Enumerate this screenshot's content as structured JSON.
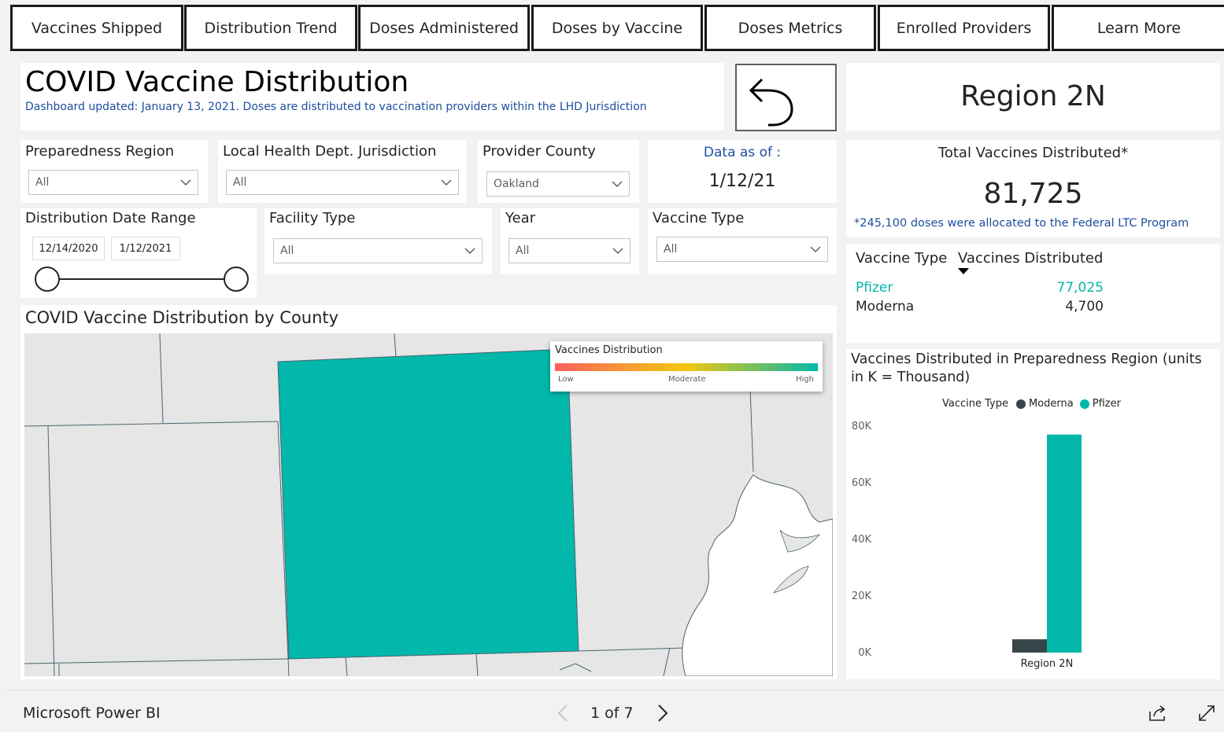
{
  "tabs": [
    {
      "label": "Vaccines Shipped"
    },
    {
      "label": "Distribution Trend"
    },
    {
      "label": "Doses Administered"
    },
    {
      "label": "Doses by Vaccine"
    },
    {
      "label": "Doses Metrics"
    },
    {
      "label": "Enrolled Providers"
    },
    {
      "label": "Learn More"
    }
  ],
  "header": {
    "title": "COVID Vaccine Distribution",
    "subtitle": "Dashboard updated: January 13, 2021. Doses are distributed to vaccination providers within the LHD Jurisdiction",
    "back_icon": "back-arrow-icon"
  },
  "region_card": {
    "label": "Region 2N"
  },
  "filters": {
    "preparedness_region": {
      "title": "Preparedness Region",
      "value": "All"
    },
    "lhd_jurisdiction": {
      "title": "Local Health Dept. Jurisdiction",
      "value": "All"
    },
    "provider_county": {
      "title": "Provider County",
      "value": "Oakland"
    },
    "data_as_of": {
      "title": "Data as of :",
      "value": "1/12/21"
    },
    "date_range": {
      "title": "Distribution Date Range",
      "start": "12/14/2020",
      "end": "1/12/2021"
    },
    "facility_type": {
      "title": "Facility Type",
      "value": "All"
    },
    "year": {
      "title": "Year",
      "value": "All"
    },
    "vaccine_type": {
      "title": "Vaccine Type",
      "value": "All"
    }
  },
  "total_card": {
    "title": "Total Vaccines Distributed*",
    "value": "81,725",
    "footnote": "*245,100 doses were allocated to the Federal LTC Program"
  },
  "table": {
    "headers": [
      "Vaccine Type",
      "Vaccines Distributed"
    ],
    "rows": [
      {
        "type": "Pfizer",
        "value": "77,025"
      },
      {
        "type": "Moderna",
        "value": "4,700"
      }
    ],
    "colors": {
      "pfizer": "#01b8aa",
      "moderna": "#252423"
    }
  },
  "map": {
    "title": "COVID Vaccine Distribution by County",
    "legend": {
      "title": "Vaccines Distribution",
      "low": "Low",
      "moderate": "Moderate",
      "high": "High"
    },
    "highlight_color": "#01b8aa"
  },
  "chart_data": {
    "type": "bar",
    "title": "Vaccines Distributed in Preparedness Region (units in K = Thousand)",
    "legend_title": "Vaccine Type",
    "categories": [
      "Region 2N"
    ],
    "series": [
      {
        "name": "Moderna",
        "values": [
          4700
        ],
        "color": "#374649"
      },
      {
        "name": "Pfizer",
        "values": [
          77025
        ],
        "color": "#01b8aa"
      }
    ],
    "yticks": [
      "0K",
      "20K",
      "40K",
      "60K",
      "80K"
    ],
    "ylim": [
      0,
      80000
    ],
    "legend_placement": "top"
  },
  "footer": {
    "brand": "Microsoft Power BI",
    "page_indicator": "1 of 7"
  }
}
